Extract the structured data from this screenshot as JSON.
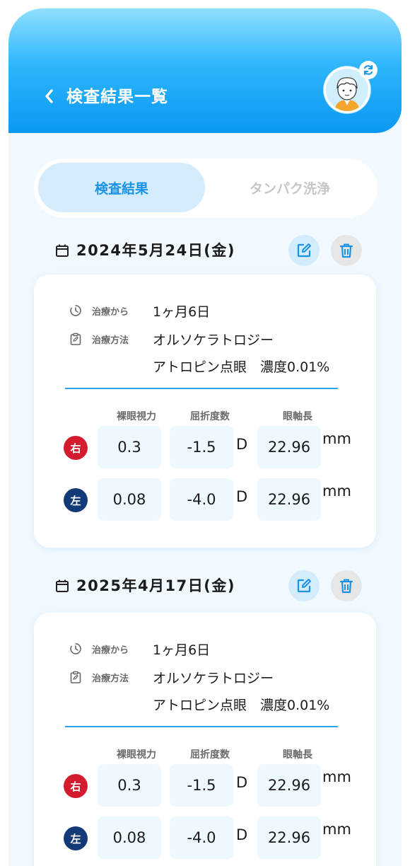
{
  "header": {
    "title": "検査結果一覧"
  },
  "tabs": [
    {
      "label": "検査結果",
      "active": true
    },
    {
      "label": "タンパク洗浄",
      "active": false
    }
  ],
  "columns": {
    "naked_eye": "裸眼視力",
    "refraction": "屈折度数",
    "axial_length": "眼軸長"
  },
  "units": {
    "refraction": "D",
    "axial_length": "mm"
  },
  "eyes": {
    "right": "右",
    "left": "左"
  },
  "records": [
    {
      "date": "2024年5月24日(金)",
      "treatment_label": "治療から",
      "treatment_value": "1ヶ月6日",
      "method_label": "治療方法",
      "method_line1": "オルソケラトロジー",
      "method_line2": "アトロピン点眼　濃度0.01%",
      "right": {
        "naked_eye": "0.3",
        "refraction": "-1.5",
        "axial_length": "22.96"
      },
      "left": {
        "naked_eye": "0.08",
        "refraction": "-4.0",
        "axial_length": "22.96"
      }
    },
    {
      "date": "2025年4月17日(金)",
      "treatment_label": "治療から",
      "treatment_value": "1ヶ月6日",
      "method_label": "治療方法",
      "method_line1": "オルソケラトロジー",
      "method_line2": "アトロピン点眼　濃度0.01%",
      "right": {
        "naked_eye": "0.3",
        "refraction": "-1.5",
        "axial_length": "22.96"
      },
      "left": {
        "naked_eye": "0.08",
        "refraction": "-4.0",
        "axial_length": "22.96"
      }
    }
  ],
  "colors": {
    "accent": "#1a93e6",
    "right_eye": "#d41a2e",
    "left_eye": "#123a76"
  },
  "icons": [
    "back-chevron-icon",
    "refresh-icon",
    "calendar-icon",
    "edit-icon",
    "trash-icon",
    "timer-icon",
    "clipboard-icon"
  ]
}
